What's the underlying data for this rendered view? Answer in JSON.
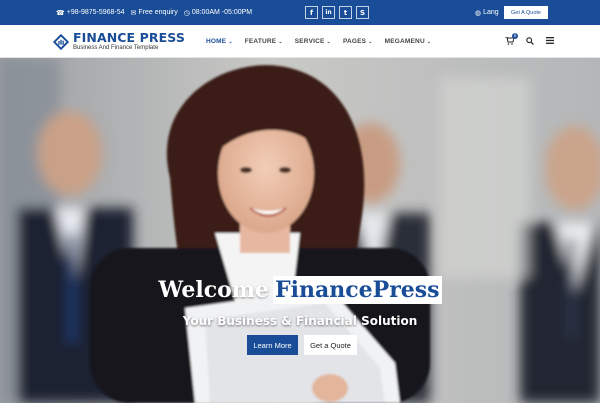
{
  "topbar": {
    "phone": "+98-9875-5968-54",
    "email_label": "Free enquiry",
    "hours": "08:00AM -05:00PM",
    "social": [
      {
        "icon": "facebook-icon",
        "glyph": "f"
      },
      {
        "icon": "linkedin-icon",
        "glyph": "in"
      },
      {
        "icon": "twitter-icon",
        "glyph": "t"
      },
      {
        "icon": "skype-icon",
        "glyph": "S"
      }
    ],
    "lang_label": "Lang",
    "quote_button": "Get A Quote"
  },
  "header": {
    "logo_name": "FINANCE PRESS",
    "logo_tagline": "Business And Finance Template",
    "nav": [
      {
        "label": "HOME",
        "active": true
      },
      {
        "label": "FEATURE",
        "active": false
      },
      {
        "label": "SERVICE",
        "active": false
      },
      {
        "label": "PAGES",
        "active": false
      },
      {
        "label": "MEGAMENU",
        "active": false
      }
    ],
    "cart_count": "0"
  },
  "hero": {
    "welcome_word": "Welcome",
    "welcome_brand": "FinancePress",
    "subtitle": "Your Business & Financial Solution",
    "learn_more": "Learn More",
    "get_quote": "Get a Quote"
  },
  "colors": {
    "brand": "#1a4d97",
    "topbar_bg": "#1a4d97"
  }
}
